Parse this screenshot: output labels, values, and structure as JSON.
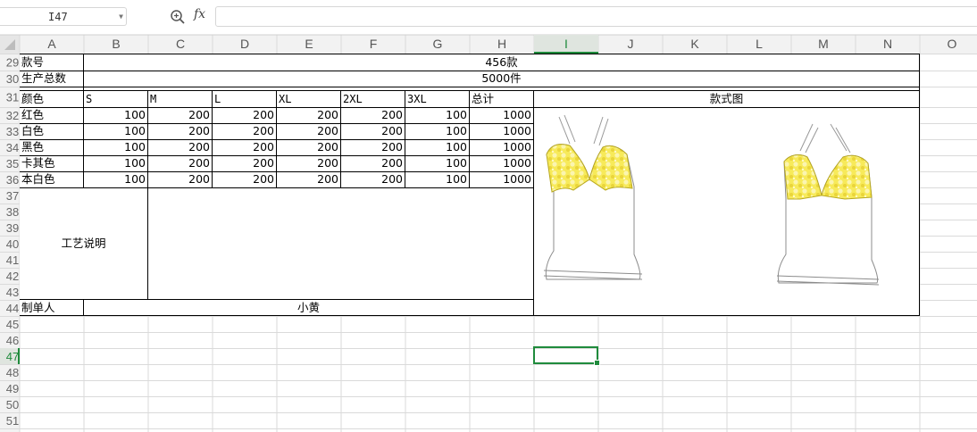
{
  "name_box": {
    "value": "I47"
  },
  "formula": {
    "fx_label": "fx",
    "value": ""
  },
  "columns": [
    "A",
    "B",
    "C",
    "D",
    "E",
    "F",
    "G",
    "H",
    "I",
    "J",
    "K",
    "L",
    "M",
    "N",
    "O"
  ],
  "selected_column": "I",
  "rows": [
    "29",
    "30",
    "31",
    "32",
    "33",
    "34",
    "35",
    "36",
    "37",
    "38",
    "39",
    "40",
    "41",
    "42",
    "43",
    "44",
    "45",
    "46",
    "47",
    "48",
    "49",
    "50",
    "51"
  ],
  "selected_row": "47",
  "sheet": {
    "style_no_label": "款号",
    "style_no_value": "456款",
    "total_label": "生产总数",
    "total_value": "5000件",
    "color_header": "颜色",
    "sizes": [
      "S",
      "M",
      "L",
      "XL",
      "2XL",
      "3XL"
    ],
    "sum_header": "总计",
    "image_header": "款式图",
    "rows": [
      {
        "color": "红色",
        "values": [
          "100",
          "200",
          "200",
          "200",
          "200",
          "100",
          "1000"
        ]
      },
      {
        "color": "白色",
        "values": [
          "100",
          "200",
          "200",
          "200",
          "200",
          "100",
          "1000"
        ]
      },
      {
        "color": "黑色",
        "values": [
          "100",
          "200",
          "200",
          "200",
          "200",
          "100",
          "1000"
        ]
      },
      {
        "color": "卡其色",
        "values": [
          "100",
          "200",
          "200",
          "200",
          "200",
          "100",
          "1000"
        ]
      },
      {
        "color": "本白色",
        "values": [
          "100",
          "200",
          "200",
          "200",
          "200",
          "100",
          "1000"
        ]
      }
    ],
    "process_label": "工艺说明",
    "process_value": "",
    "maker_label": "制单人",
    "maker_value": "小黄"
  },
  "colors": {
    "selection": "#1f8b3c",
    "print_yellow": "#f2e033",
    "gridline": "#dadada",
    "header_bg": "#f2f2f2"
  }
}
